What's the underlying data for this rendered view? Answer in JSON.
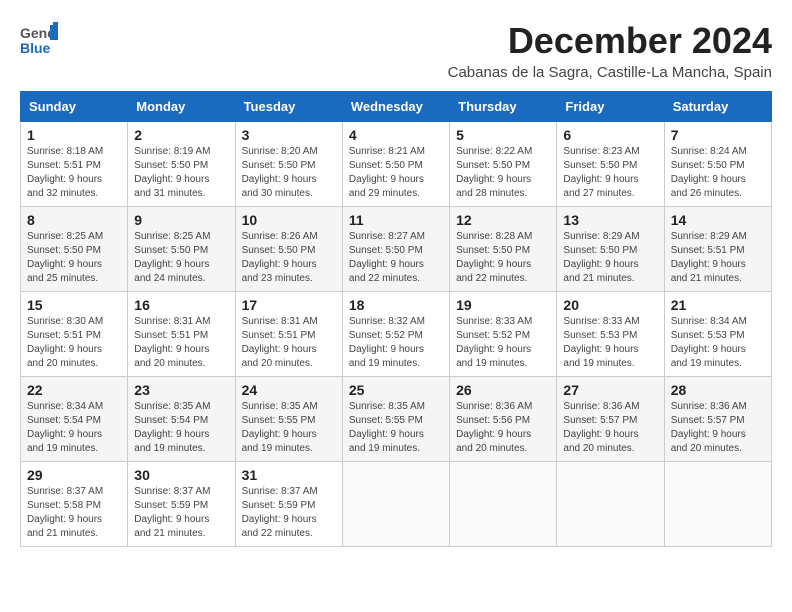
{
  "header": {
    "logo_general": "General",
    "logo_blue": "Blue",
    "month_title": "December 2024",
    "subtitle": "Cabanas de la Sagra, Castille-La Mancha, Spain"
  },
  "weekdays": [
    "Sunday",
    "Monday",
    "Tuesday",
    "Wednesday",
    "Thursday",
    "Friday",
    "Saturday"
  ],
  "weeks": [
    [
      {
        "day": "1",
        "info": "Sunrise: 8:18 AM\nSunset: 5:51 PM\nDaylight: 9 hours\nand 32 minutes."
      },
      {
        "day": "2",
        "info": "Sunrise: 8:19 AM\nSunset: 5:50 PM\nDaylight: 9 hours\nand 31 minutes."
      },
      {
        "day": "3",
        "info": "Sunrise: 8:20 AM\nSunset: 5:50 PM\nDaylight: 9 hours\nand 30 minutes."
      },
      {
        "day": "4",
        "info": "Sunrise: 8:21 AM\nSunset: 5:50 PM\nDaylight: 9 hours\nand 29 minutes."
      },
      {
        "day": "5",
        "info": "Sunrise: 8:22 AM\nSunset: 5:50 PM\nDaylight: 9 hours\nand 28 minutes."
      },
      {
        "day": "6",
        "info": "Sunrise: 8:23 AM\nSunset: 5:50 PM\nDaylight: 9 hours\nand 27 minutes."
      },
      {
        "day": "7",
        "info": "Sunrise: 8:24 AM\nSunset: 5:50 PM\nDaylight: 9 hours\nand 26 minutes."
      }
    ],
    [
      {
        "day": "8",
        "info": "Sunrise: 8:25 AM\nSunset: 5:50 PM\nDaylight: 9 hours\nand 25 minutes."
      },
      {
        "day": "9",
        "info": "Sunrise: 8:25 AM\nSunset: 5:50 PM\nDaylight: 9 hours\nand 24 minutes."
      },
      {
        "day": "10",
        "info": "Sunrise: 8:26 AM\nSunset: 5:50 PM\nDaylight: 9 hours\nand 23 minutes."
      },
      {
        "day": "11",
        "info": "Sunrise: 8:27 AM\nSunset: 5:50 PM\nDaylight: 9 hours\nand 22 minutes."
      },
      {
        "day": "12",
        "info": "Sunrise: 8:28 AM\nSunset: 5:50 PM\nDaylight: 9 hours\nand 22 minutes."
      },
      {
        "day": "13",
        "info": "Sunrise: 8:29 AM\nSunset: 5:50 PM\nDaylight: 9 hours\nand 21 minutes."
      },
      {
        "day": "14",
        "info": "Sunrise: 8:29 AM\nSunset: 5:51 PM\nDaylight: 9 hours\nand 21 minutes."
      }
    ],
    [
      {
        "day": "15",
        "info": "Sunrise: 8:30 AM\nSunset: 5:51 PM\nDaylight: 9 hours\nand 20 minutes."
      },
      {
        "day": "16",
        "info": "Sunrise: 8:31 AM\nSunset: 5:51 PM\nDaylight: 9 hours\nand 20 minutes."
      },
      {
        "day": "17",
        "info": "Sunrise: 8:31 AM\nSunset: 5:51 PM\nDaylight: 9 hours\nand 20 minutes."
      },
      {
        "day": "18",
        "info": "Sunrise: 8:32 AM\nSunset: 5:52 PM\nDaylight: 9 hours\nand 19 minutes."
      },
      {
        "day": "19",
        "info": "Sunrise: 8:33 AM\nSunset: 5:52 PM\nDaylight: 9 hours\nand 19 minutes."
      },
      {
        "day": "20",
        "info": "Sunrise: 8:33 AM\nSunset: 5:53 PM\nDaylight: 9 hours\nand 19 minutes."
      },
      {
        "day": "21",
        "info": "Sunrise: 8:34 AM\nSunset: 5:53 PM\nDaylight: 9 hours\nand 19 minutes."
      }
    ],
    [
      {
        "day": "22",
        "info": "Sunrise: 8:34 AM\nSunset: 5:54 PM\nDaylight: 9 hours\nand 19 minutes."
      },
      {
        "day": "23",
        "info": "Sunrise: 8:35 AM\nSunset: 5:54 PM\nDaylight: 9 hours\nand 19 minutes."
      },
      {
        "day": "24",
        "info": "Sunrise: 8:35 AM\nSunset: 5:55 PM\nDaylight: 9 hours\nand 19 minutes."
      },
      {
        "day": "25",
        "info": "Sunrise: 8:35 AM\nSunset: 5:55 PM\nDaylight: 9 hours\nand 19 minutes."
      },
      {
        "day": "26",
        "info": "Sunrise: 8:36 AM\nSunset: 5:56 PM\nDaylight: 9 hours\nand 20 minutes."
      },
      {
        "day": "27",
        "info": "Sunrise: 8:36 AM\nSunset: 5:57 PM\nDaylight: 9 hours\nand 20 minutes."
      },
      {
        "day": "28",
        "info": "Sunrise: 8:36 AM\nSunset: 5:57 PM\nDaylight: 9 hours\nand 20 minutes."
      }
    ],
    [
      {
        "day": "29",
        "info": "Sunrise: 8:37 AM\nSunset: 5:58 PM\nDaylight: 9 hours\nand 21 minutes."
      },
      {
        "day": "30",
        "info": "Sunrise: 8:37 AM\nSunset: 5:59 PM\nDaylight: 9 hours\nand 21 minutes."
      },
      {
        "day": "31",
        "info": "Sunrise: 8:37 AM\nSunset: 5:59 PM\nDaylight: 9 hours\nand 22 minutes."
      },
      {
        "day": "",
        "info": ""
      },
      {
        "day": "",
        "info": ""
      },
      {
        "day": "",
        "info": ""
      },
      {
        "day": "",
        "info": ""
      }
    ]
  ]
}
